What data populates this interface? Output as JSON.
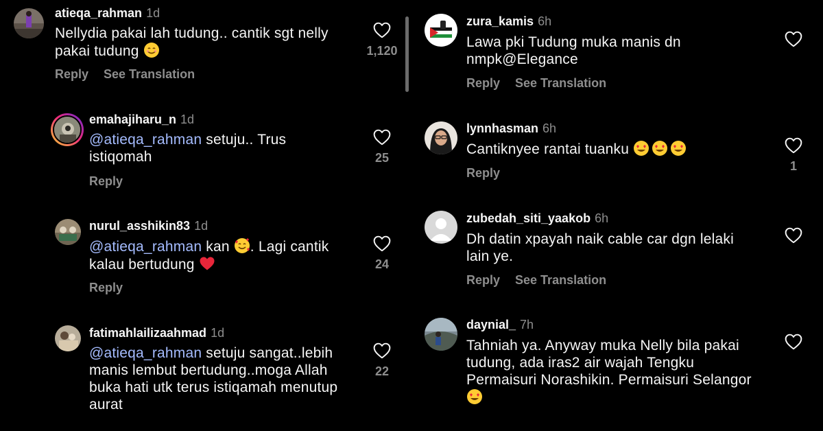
{
  "left_comments": [
    {
      "username": "atieqa_rahman",
      "time": "1d",
      "text_parts": [
        "Nellydia pakai lah tudung.. cantik sgt nelly",
        "pakai tudung"
      ],
      "emoji": "smiling-face-emoji",
      "actions": [
        "Reply",
        "See Translation"
      ],
      "likes": "1,120"
    },
    {
      "username": "emahajiharu_n",
      "time": "1d",
      "mention": "@atieqa_rahman",
      "text_parts": [
        " setuju.. Trus",
        "istiqomah"
      ],
      "actions": [
        "Reply"
      ],
      "likes": "25"
    },
    {
      "username": "nurul_asshikin83",
      "time": "1d",
      "mention": "@atieqa_rahman",
      "text_parts": [
        " kan ",
        ". Lagi cantik",
        "kalau bertudung "
      ],
      "emoji": "smiling-face-with-hearts-emoji",
      "emoji2": "red-heart-emoji",
      "actions": [
        "Reply"
      ],
      "likes": "24"
    },
    {
      "username": "fatimahlailizaahmad",
      "time": "1d",
      "mention": "@atieqa_rahman",
      "text_parts": [
        " setuju sangat..lebih",
        "manis lembut bertudung..moga Allah",
        "buka hati utk terus istiqamah menutup",
        "aurat"
      ],
      "actions": [],
      "likes": "22"
    }
  ],
  "right_comments": [
    {
      "username": "zura_kamis",
      "time": "6h",
      "text_parts": [
        "Lawa pki Tudung  muka manis dn",
        "nmpk@Elegance"
      ],
      "actions": [
        "Reply",
        "See Translation"
      ],
      "likes": ""
    },
    {
      "username": "lynnhasman",
      "time": "6h",
      "text_parts": [
        "Cantiknyee rantai tuanku "
      ],
      "emoji": "heart-eyes-emoji",
      "actions": [
        "Reply"
      ],
      "likes": "1"
    },
    {
      "username": "zubedah_siti_yaakob",
      "time": "6h",
      "text_parts": [
        "Dh datin xpayah naik cable car dgn lelaki",
        "lain ye."
      ],
      "actions": [
        "Reply",
        "See Translation"
      ],
      "likes": ""
    },
    {
      "username": "daynial_",
      "time": "7h",
      "text_parts": [
        "Tahniah ya. Anyway muka Nelly bila pakai",
        "tudung, ada iras2 air wajah Tengku",
        "Permaisuri Norashikin. Permaisuri Selangor"
      ],
      "emoji": "heart-eyes-emoji",
      "actions": [],
      "likes": ""
    }
  ],
  "colors": {
    "background": "#000000",
    "text": "#f5f5f5",
    "muted": "#8e8e8e",
    "mention": "#a5bcff"
  }
}
